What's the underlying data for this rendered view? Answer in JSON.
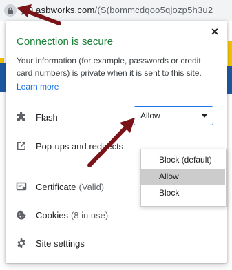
{
  "browser": {
    "url_prefix": "j",
    "url_host": "s0.asbworks.com",
    "url_path": "/(S(bommcdqoo5qjozp5h3u2"
  },
  "popup": {
    "close_glyph": "×",
    "title": "Connection is secure",
    "description": "Your information (for example, passwords or credit card numbers) is private when it is sent to this site.",
    "learn_more": "Learn more",
    "permissions": [
      {
        "label": "Flash",
        "icon": "puzzle-icon",
        "value": "Allow"
      },
      {
        "label": "Pop-ups and redirects",
        "icon": "popup-icon"
      }
    ],
    "dropdown_options": [
      "Block (default)",
      "Allow",
      "Block"
    ],
    "dropdown_highlighted": "Allow",
    "certificate": {
      "label": "Certificate",
      "status": "(Valid)"
    },
    "cookies": {
      "label": "Cookies",
      "status": "(8 in use)"
    },
    "site_settings": {
      "label": "Site settings"
    }
  },
  "colors": {
    "secure_green": "#188038",
    "link_blue": "#1a73e8",
    "annotation_arrow": "#7a1419"
  }
}
